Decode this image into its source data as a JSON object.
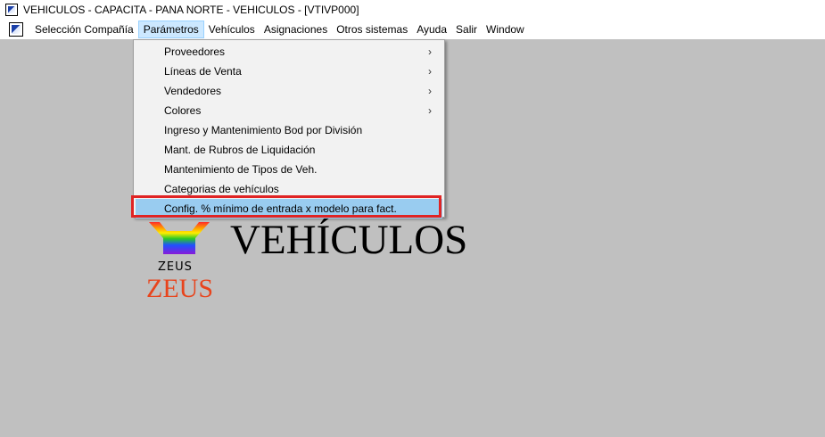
{
  "window": {
    "title": "VEHICULOS - CAPACITA - PANA NORTE - VEHICULOS - [VTIVP000]"
  },
  "menubar": {
    "items": [
      {
        "label": "Selección Compañía"
      },
      {
        "label": "Parámetros"
      },
      {
        "label": "Vehículos"
      },
      {
        "label": "Asignaciones"
      },
      {
        "label": "Otros sistemas"
      },
      {
        "label": "Ayuda"
      },
      {
        "label": "Salir"
      },
      {
        "label": "Window"
      }
    ]
  },
  "dropdown": {
    "items": [
      {
        "label": "Proveedores",
        "submenu": true
      },
      {
        "label": "Líneas de Venta",
        "submenu": true
      },
      {
        "label": "Vendedores",
        "submenu": true
      },
      {
        "label": "Colores",
        "submenu": true
      },
      {
        "label": "Ingreso y Mantenimiento Bod por División"
      },
      {
        "label": "Mant. de Rubros de Liquidación"
      },
      {
        "label": "Mantenimiento de Tipos de Veh."
      },
      {
        "label": "Categorias de vehículos"
      },
      {
        "label": "Config. % mínimo de entrada x modelo para fact.",
        "highlighted": true
      }
    ]
  },
  "branding": {
    "logo_small_text": "ZEUS",
    "logo_red_text": "ZEUS",
    "app_name": "VEHÍCULOS"
  },
  "colors": {
    "workspace": "#c0c0c0",
    "highlight": "#99ccf0",
    "annotation": "#e02424",
    "zeus_red": "#e8441c"
  }
}
